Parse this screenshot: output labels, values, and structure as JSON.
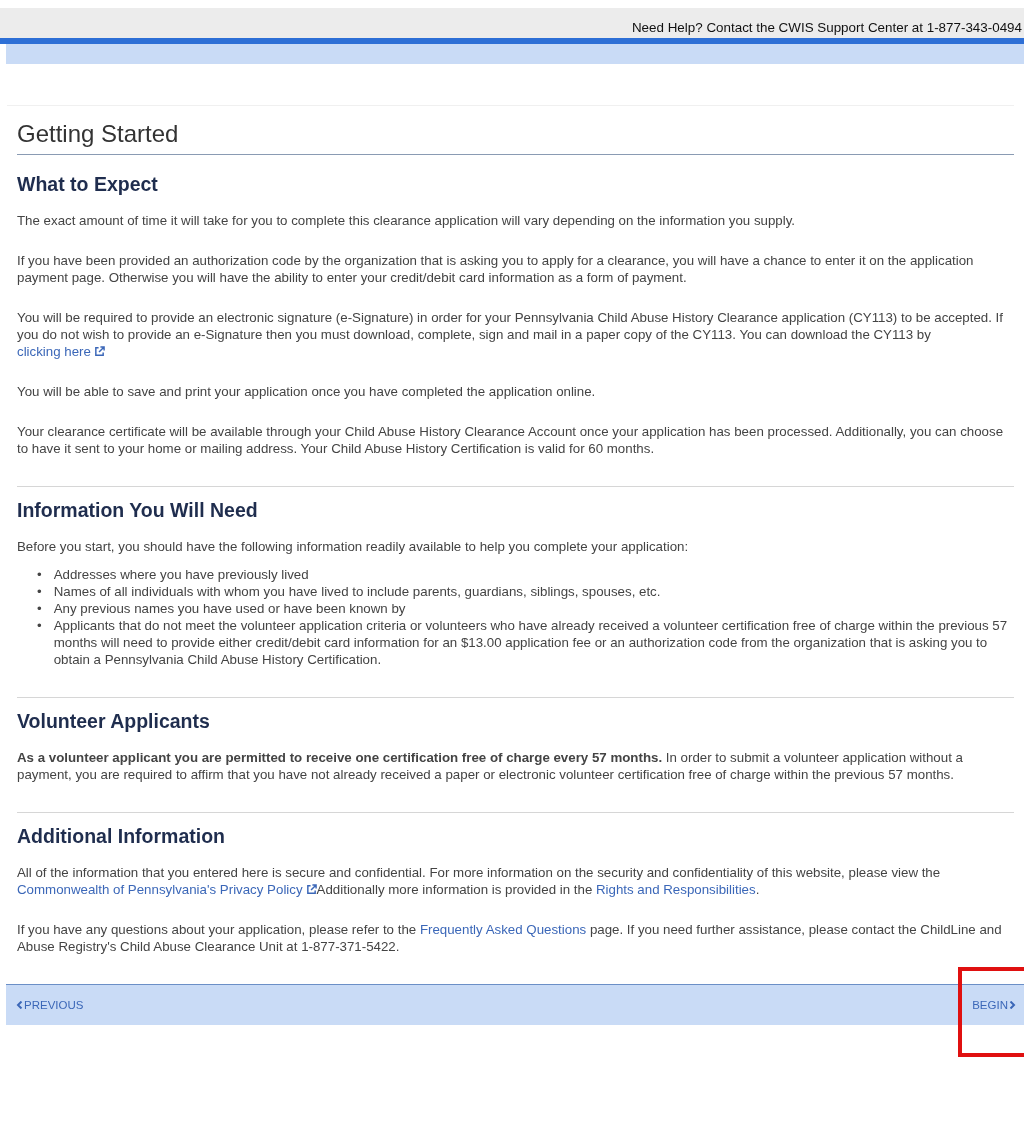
{
  "header": {
    "help_text": "Need Help? Contact the CWIS Support Center at 1-877-343-0494"
  },
  "page_title": "Getting Started",
  "sections": [
    {
      "heading": "What to Expect",
      "blocks": [
        {
          "kind": "paragraph",
          "parts": [
            {
              "kind": "text",
              "text": "The exact amount of time it will take for you to complete this clearance application will vary depending on the information you supply."
            }
          ]
        },
        {
          "kind": "paragraph",
          "parts": [
            {
              "kind": "text",
              "text": "If you have been provided an authorization code by the organization that is asking you to apply for a clearance, you will have a chance to enter it on the application payment page. Otherwise you will have the ability to enter your credit/debit card information as a form of payment."
            }
          ]
        },
        {
          "kind": "paragraph",
          "parts": [
            {
              "kind": "text",
              "text": "You will be required to provide an electronic signature (e-Signature) in order for your Pennsylvania Child Abuse History Clearance application (CY113) to be accepted. If you do not wish to provide an e-Signature then you must download, complete, sign and mail in a paper copy of the CY113. You can download the CY113 by "
            },
            {
              "kind": "link",
              "text": "clicking here",
              "external": true
            }
          ]
        },
        {
          "kind": "paragraph",
          "parts": [
            {
              "kind": "text",
              "text": "You will be able to save and print your application once you have completed the application online."
            }
          ]
        },
        {
          "kind": "paragraph",
          "parts": [
            {
              "kind": "text",
              "text": "Your clearance certificate will be available through your Child Abuse History Clearance Account once your application has been processed. Additionally, you can choose to have it sent to your home or mailing address. Your Child Abuse History Certification is valid for 60 months."
            }
          ]
        }
      ]
    },
    {
      "heading": "Information You Will Need",
      "blocks": [
        {
          "kind": "paragraph",
          "parts": [
            {
              "kind": "text",
              "text": "Before you start, you should have the following information readily available to help you complete your application:"
            }
          ]
        },
        {
          "kind": "list",
          "marker": "•",
          "items": [
            "Addresses where you have previously lived",
            "Names of all individuals with whom you have lived to include parents, guardians, siblings, spouses, etc.",
            "Any previous names you have used or have been known by",
            "Applicants that do not meet the volunteer application criteria or volunteers who have already received a volunteer certification free of charge within the previous 57 months will need to provide either credit/debit card information for an $13.00 application fee or an authorization code from the organization that is asking you to obtain a Pennsylvania Child Abuse History Certification."
          ]
        }
      ]
    },
    {
      "heading": "Volunteer Applicants",
      "blocks": [
        {
          "kind": "paragraph",
          "parts": [
            {
              "kind": "bold",
              "text": "As a volunteer applicant you are permitted to receive one certification free of charge every 57 months."
            },
            {
              "kind": "text",
              "text": " In order to submit a volunteer application without a payment, you are required to affirm that you have not already received a paper or electronic volunteer certification free of charge within the previous 57 months."
            }
          ]
        }
      ]
    },
    {
      "heading": "Additional Information",
      "blocks": [
        {
          "kind": "paragraph",
          "parts": [
            {
              "kind": "text",
              "text": "All of the information that you entered here is secure and confidential. For more information on the security and confidentiality of this website, please view the "
            },
            {
              "kind": "link",
              "text": "Commonwealth of Pennsylvania's Privacy Policy",
              "external": true
            },
            {
              "kind": "text",
              "text": "Additionally more information is provided in the "
            },
            {
              "kind": "link",
              "text": "Rights and Responsibilities",
              "external": false
            },
            {
              "kind": "text",
              "text": "."
            }
          ]
        },
        {
          "kind": "paragraph",
          "parts": [
            {
              "kind": "text",
              "text": "If you have any questions about your application, please refer to the "
            },
            {
              "kind": "link",
              "text": "Frequently Asked Questions",
              "external": false
            },
            {
              "kind": "text",
              "text": " page. If you need further assistance, please contact the ChildLine and Abuse Registry's Child Abuse Clearance Unit at 1-877-371-5422."
            }
          ]
        }
      ]
    }
  ],
  "footer": {
    "previous": "PREVIOUS",
    "begin": "BEGIN",
    "begin_highlighted": true
  }
}
